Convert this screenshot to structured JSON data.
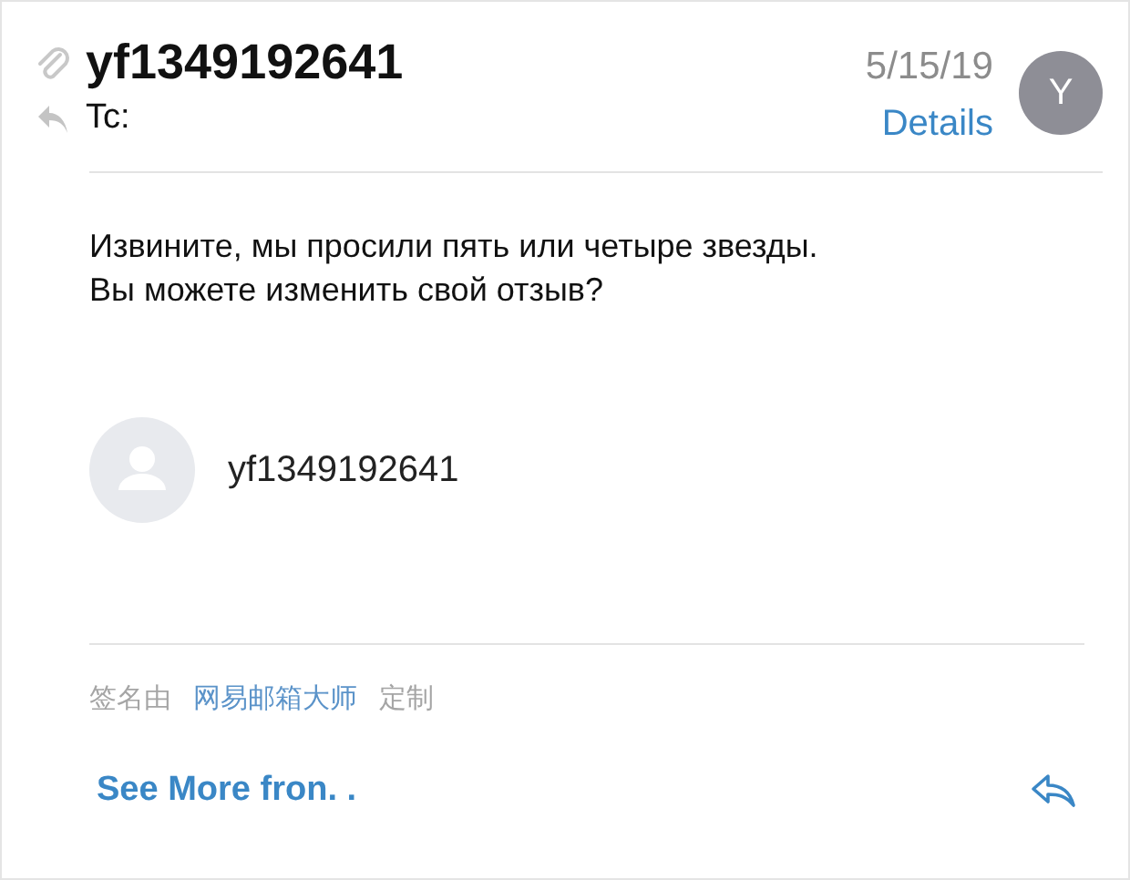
{
  "header": {
    "sender": "yf1349192641",
    "date": "5/15/19",
    "to_label": "Tc:",
    "details_link": "Details",
    "avatar_letter": "Y"
  },
  "body": {
    "lines": [
      "Извините, мы просили пять или четыре звезды.",
      "Вы можете изменить свой отзыв?"
    ]
  },
  "signature": {
    "name": "yf1349192641"
  },
  "signature_note": {
    "prefix": "签名由",
    "link": "网易邮箱大师",
    "suffix": "定制"
  },
  "footer": {
    "see_more": "See More fron. ."
  }
}
